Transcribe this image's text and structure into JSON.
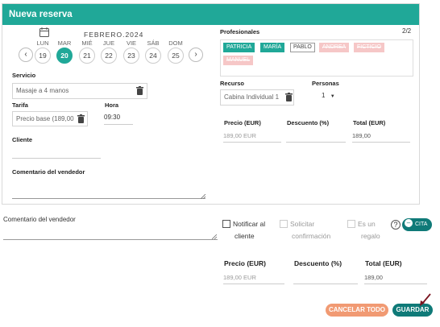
{
  "header": {
    "title": "Nueva reserva"
  },
  "calendar": {
    "month_label": "FEBRERO.2024",
    "prev": "‹",
    "next": "›",
    "days": [
      {
        "label": "LUN",
        "num": "19"
      },
      {
        "label": "MAR",
        "num": "20"
      },
      {
        "label": "MIÉ",
        "num": "21"
      },
      {
        "label": "JUE",
        "num": "22"
      },
      {
        "label": "VIE",
        "num": "23"
      },
      {
        "label": "SÁB",
        "num": "24"
      },
      {
        "label": "DOM",
        "num": "25"
      }
    ],
    "selected_day": "20"
  },
  "form": {
    "servicio_label": "Servicio",
    "servicio_value": "Masaje a 4 manos",
    "tarifa_label": "Tarifa",
    "tarifa_value": "Precio base (189,00",
    "hora_label": "Hora",
    "hora_value": "09:30",
    "cliente_label": "Cliente",
    "comentario_label": "Comentario del vendedor"
  },
  "profesionales": {
    "label": "Profesionales",
    "page": "2/2",
    "chips": [
      {
        "name": "PATRICIA",
        "state": "on"
      },
      {
        "name": "MARÍA",
        "state": "on"
      },
      {
        "name": "PABLO",
        "state": "off"
      },
      {
        "name": "ANDREA",
        "state": "unavailable"
      },
      {
        "name": "FICTICIO",
        "state": "unavailable"
      },
      {
        "name": "MANUEL",
        "state": "unavailable"
      }
    ]
  },
  "recurso": {
    "label": "Recurso",
    "value": "Cabina Individual 1"
  },
  "personas": {
    "label": "Personas",
    "value": "1"
  },
  "pricing": {
    "precio_label": "Precio (EUR)",
    "descuento_label": "Descuento (%)",
    "total_label": "Total (EUR)",
    "precio_value": "189,00 EUR",
    "total_value": "189,00"
  },
  "lower": {
    "comentario_label": "Comentario del vendedor",
    "notificar": [
      "Notificar al",
      "cliente"
    ],
    "solicitar": [
      "Solicitar",
      "confirmación"
    ],
    "regalo": [
      "Es un",
      "regalo"
    ],
    "help": "?",
    "cita_label": "CITA",
    "precio_label": "Precio (EUR)",
    "descuento_label": "Descuento (%)",
    "total_label": "Total (EUR)",
    "precio_value": "189,00 EUR",
    "total_value": "189,00"
  },
  "actions": {
    "cancel_label": "CANCELAR TODO",
    "save_label": "GUARDAR"
  },
  "colors": {
    "accent": "#20a898",
    "dark_teal": "#0f7a78",
    "cancel": "#f19a73",
    "arrow": "#7a1420"
  }
}
